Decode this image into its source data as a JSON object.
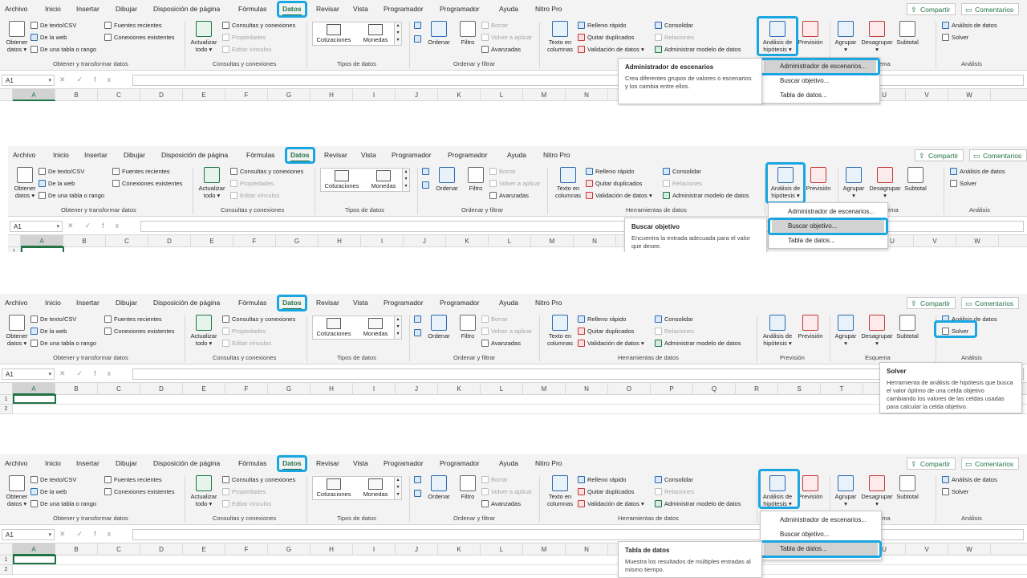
{
  "menu": {
    "tabs": [
      "Archivo",
      "Inicio",
      "Insertar",
      "Dibujar",
      "Disposición de página",
      "Fórmulas",
      "Datos",
      "Revisar",
      "Vista",
      "Programador",
      "Programador",
      "Ayuda",
      "Nitro Pro"
    ],
    "active_tab": "Datos",
    "share_label": "Compartir",
    "comments_label": "Comentarios"
  },
  "ribbon": {
    "get_data": {
      "obtener_line1": "Obtener",
      "obtener_line2": "datos",
      "from_text_csv": "De texto/CSV",
      "from_web": "De la web",
      "from_table": "De una tabla o rango",
      "recent_sources": "Fuentes recientes",
      "existing_connections": "Conexiones existentes",
      "label": "Obtener y transformar datos"
    },
    "queries": {
      "refresh_line1": "Actualizar",
      "refresh_line2": "todo",
      "queries_connections": "Consultas y conexiones",
      "properties": "Propiedades",
      "edit_links": "Editar vínculos",
      "label": "Consultas y conexiones"
    },
    "data_types": {
      "stocks": "Cotizaciones",
      "currencies": "Monedas",
      "label": "Tipos de datos"
    },
    "sort_filter": {
      "sort": "Ordenar",
      "filter": "Filtro",
      "clear": "Borrar",
      "reapply": "Volver a aplicar",
      "advanced": "Avanzadas",
      "label": "Ordenar y filtrar"
    },
    "data_tools": {
      "text_to_columns_line1": "Texto en",
      "text_to_columns_line2": "columnas",
      "flash_fill": "Relleno rápido",
      "remove_duplicates": "Quitar duplicados",
      "data_validation": "Validación de datos",
      "consolidate": "Consolidar",
      "relationships": "Relaciones",
      "data_model": "Administrar modelo de datos",
      "label": "Herramientas de datos"
    },
    "forecast": {
      "whatif_line1": "Análisis de",
      "whatif_line2": "hipótesis",
      "forecast_sheet": "Previsión",
      "label": "Previsión"
    },
    "outline": {
      "group": "Agrupar",
      "ungroup": "Desagrupar",
      "subtotal": "Subtotal",
      "label": "Esquema"
    },
    "analysis": {
      "data_analysis": "Análisis de datos",
      "solver": "Solver",
      "label": "Análisis"
    }
  },
  "formula_bar": {
    "name_box": "A1",
    "fx": "fx",
    "cancel": "✕",
    "enter": "✓"
  },
  "columns": [
    "A",
    "B",
    "C",
    "D",
    "E",
    "F",
    "G",
    "H",
    "I",
    "J",
    "K",
    "L",
    "M",
    "N",
    "O",
    "P",
    "Q",
    "R",
    "S",
    "T",
    "U",
    "V",
    "W"
  ],
  "rows": [
    "1",
    "2"
  ],
  "whatif_menu": {
    "scenario_manager": "Administrador de escenarios...",
    "goal_seek": "Buscar objetivo...",
    "data_table": "Tabla de datos..."
  },
  "tooltips": {
    "scenario": {
      "title": "Administrador de escenarios",
      "desc": "Crea diferentes grupos de valores o escenarios y los cambia entre ellos."
    },
    "goal_seek": {
      "title": "Buscar objetivo",
      "desc": "Encuentra la entrada adecuada para el valor que desee."
    },
    "solver": {
      "title": "Solver",
      "desc": "Herramienta de análisis de hipótesis que busca el valor óptimo de una celda objetivo cambiando los valores de las celdas usadas para calcular la celda objetivo."
    },
    "data_table": {
      "title": "Tabla de datos",
      "desc": "Muestra los resultados de múltiples entradas al mismo tiempo."
    }
  },
  "colors": {
    "accent_green": "#217346",
    "highlight_blue": "#1aa6e0",
    "ribbon_bg": "#f3f3f3"
  }
}
